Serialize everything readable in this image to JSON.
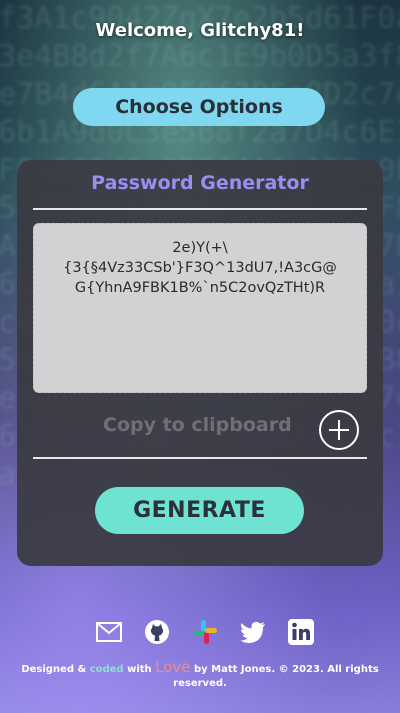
{
  "welcome": "Welcome, Glitchy81!",
  "choose_button": "Choose Options",
  "generator": {
    "title": "Password Generator",
    "password_line1": "2e)Y(+\\",
    "password_line2": "{3{§4Vz33CSb'}F3Q^13dU7,!A3cG@",
    "password_line3": "G{YhnA9FBK1B%`n5C2ovQzTHt)R",
    "copy_label": "Copy to clipboard",
    "generate_button": "GENERATE"
  },
  "social": [
    "mail-icon",
    "github-icon",
    "slack-icon",
    "twitter-icon",
    "linkedin-icon"
  ],
  "footer": {
    "designed": "Designed &",
    "coded": "coded",
    "with": "with",
    "love": "Love",
    "rest": "by Matt Jones. © 2023. All rights reserved."
  },
  "colors": {
    "choose_button": "#7fd8ef",
    "title": "#9b8df2",
    "generate_button": "#6fe3d2",
    "coded": "#8ee0cf",
    "love": "#f08a86"
  }
}
